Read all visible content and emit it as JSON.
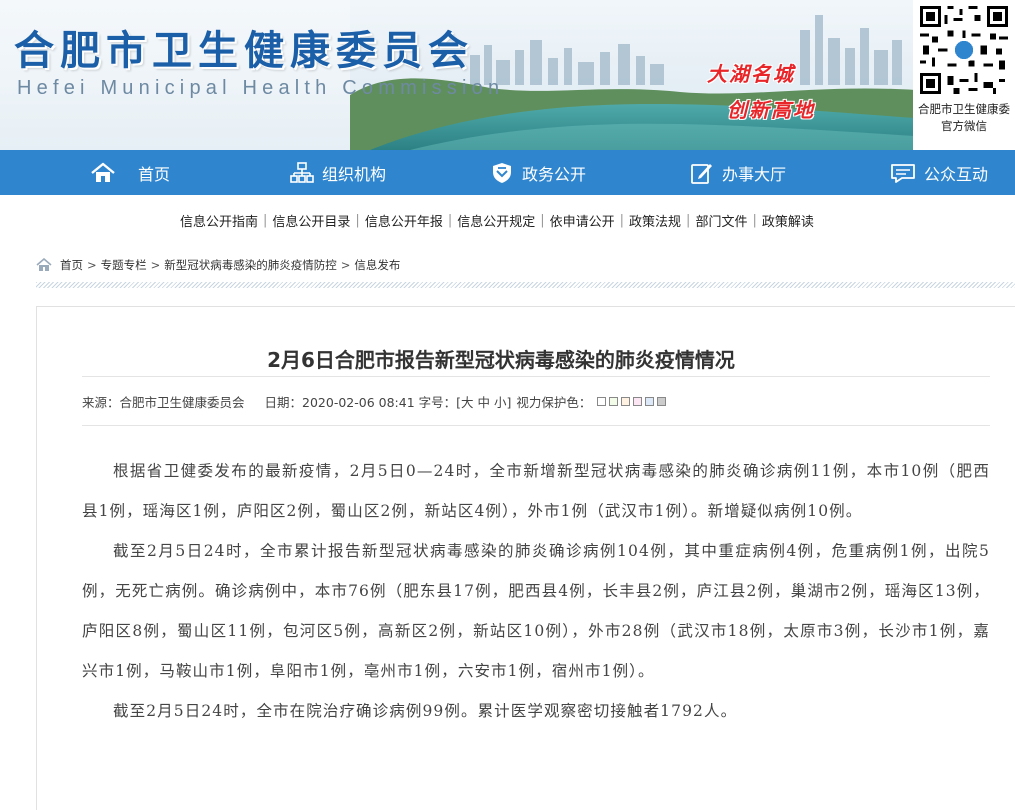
{
  "header": {
    "title": "合肥市卫生健康委员会",
    "subtitle": "Hefei Municipal Health Commission",
    "slogan_line1": "大湖名城",
    "slogan_line2": "创新高地",
    "qr_caption_line1": "合肥市卫生健康委",
    "qr_caption_line2": "官方微信"
  },
  "nav": {
    "items": [
      {
        "label": "首页",
        "icon": "home-icon"
      },
      {
        "label": "组织机构",
        "icon": "org-chart-icon"
      },
      {
        "label": "政务公开",
        "icon": "shield-icon"
      },
      {
        "label": "办事大厅",
        "icon": "edit-icon"
      },
      {
        "label": "公众互动",
        "icon": "chat-icon"
      }
    ]
  },
  "sublinks": [
    "信息公开指南",
    "信息公开目录",
    "信息公开年报",
    "信息公开规定",
    "依申请公开",
    "政策法规",
    "部门文件",
    "政策解读"
  ],
  "breadcrumb": {
    "items": [
      "首页",
      "专题专栏",
      "新型冠状病毒感染的肺炎疫情防控",
      "信息发布"
    ],
    "separator": ">"
  },
  "article": {
    "title": "2月6日合肥市报告新型冠状病毒感染的肺炎疫情情况",
    "meta": {
      "source": "来源：合肥市卫生健康委员会",
      "date": "日期：2020-02-06 08:41",
      "font_size_label": "字号：[大 中 小]",
      "eye_color_label": "视力保护色：",
      "swatch_colors": [
        "#ffffff",
        "#f3fbe9",
        "#fff2e2",
        "#fde6f3",
        "#dde9f9",
        "#cccccc"
      ]
    },
    "paragraphs": [
      "根据省卫健委发布的最新疫情，2月5日0—24时，全市新增新型冠状病毒感染的肺炎确诊病例11例，本市10例（肥西县1例，瑶海区1例，庐阳区2例，蜀山区2例，新站区4例），外市1例（武汉市1例）。新增疑似病例10例。",
      "截至2月5日24时，全市累计报告新型冠状病毒感染的肺炎确诊病例104例，其中重症病例4例，危重病例1例，出院5例，无死亡病例。确诊病例中，本市76例（肥东县17例，肥西县4例，长丰县2例，庐江县2例，巢湖市2例，瑶海区13例，庐阳区8例，蜀山区11例，包河区5例，高新区2例，新站区10例），外市28例（武汉市18例，太原市3例，长沙市1例，嘉兴市1例，马鞍山市1例，阜阳市1例，亳州市1例，六安市1例，宿州市1例）。",
      "截至2月5日24时，全市在院治疗确诊病例99例。累计医学观察密切接触者1792人。"
    ]
  }
}
